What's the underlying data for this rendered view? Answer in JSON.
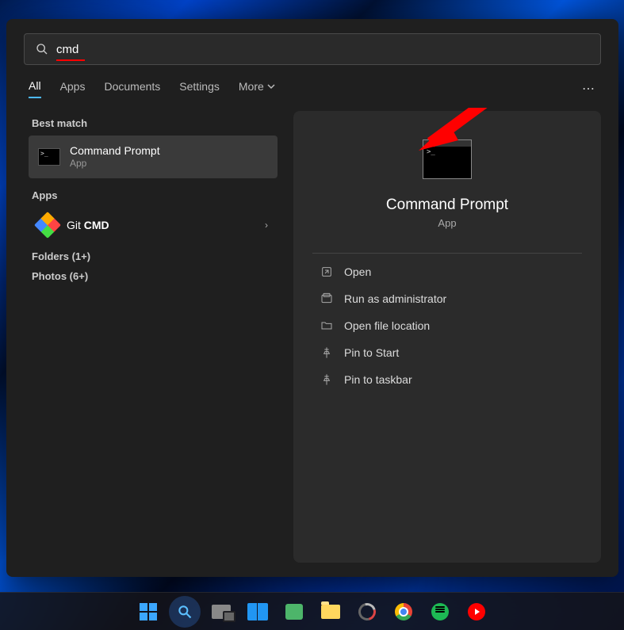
{
  "search": {
    "value": "cmd"
  },
  "tabs": {
    "items": [
      "All",
      "Apps",
      "Documents",
      "Settings",
      "More"
    ],
    "active_index": 0
  },
  "left": {
    "best_match_label": "Best match",
    "best_match": {
      "title": "Command Prompt",
      "subtitle": "App"
    },
    "apps_label": "Apps",
    "apps": [
      {
        "prefix": "Git ",
        "bold": "CMD"
      }
    ],
    "folders_line": "Folders (1+)",
    "photos_line": "Photos (6+)"
  },
  "preview": {
    "title": "Command Prompt",
    "subtitle": "App",
    "actions": {
      "open": "Open",
      "run_admin": "Run as administrator",
      "open_loc": "Open file location",
      "pin_start": "Pin to Start",
      "pin_taskbar": "Pin to taskbar"
    }
  }
}
